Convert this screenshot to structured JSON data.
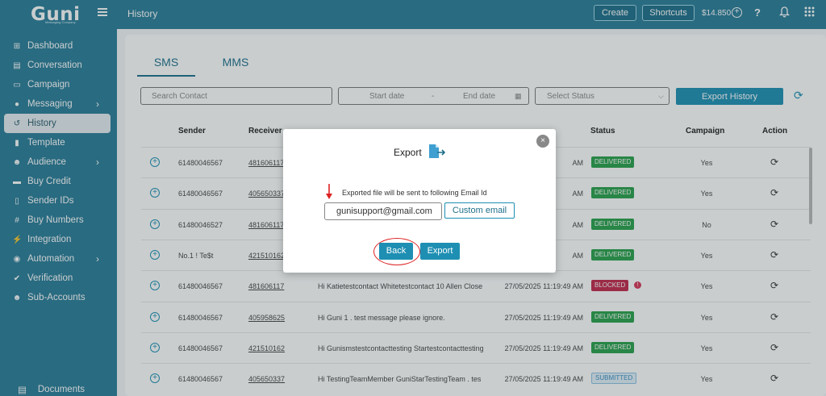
{
  "app": {
    "logo_text": "Guni",
    "logo_subtitle": "Messaging Company",
    "page_title": "History"
  },
  "topbar": {
    "create_label": "Create",
    "shortcuts_label": "Shortcuts",
    "balance": "$14.850",
    "help_label": "?"
  },
  "sidebar": {
    "items": [
      {
        "label": "Dashboard",
        "icon": "dashboard-icon",
        "glyph": "⊞"
      },
      {
        "label": "Conversation",
        "icon": "conversation-icon",
        "glyph": "▤"
      },
      {
        "label": "Campaign",
        "icon": "campaign-icon",
        "glyph": "▭"
      },
      {
        "label": "Messaging",
        "icon": "messaging-icon",
        "glyph": "●"
      },
      {
        "label": "History",
        "icon": "history-icon",
        "glyph": "↺"
      },
      {
        "label": "Template",
        "icon": "template-icon",
        "glyph": "▮"
      },
      {
        "label": "Audience",
        "icon": "audience-icon",
        "glyph": "☻"
      },
      {
        "label": "Buy Credit",
        "icon": "buy-credit-icon",
        "glyph": "▬"
      },
      {
        "label": "Sender IDs",
        "icon": "sender-ids-icon",
        "glyph": "▯"
      },
      {
        "label": "Buy Numbers",
        "icon": "buy-numbers-icon",
        "glyph": "#"
      },
      {
        "label": "Integration",
        "icon": "integration-icon",
        "glyph": "⚡"
      },
      {
        "label": "Automation",
        "icon": "automation-icon",
        "glyph": "◉"
      },
      {
        "label": "Verification",
        "icon": "verification-icon",
        "glyph": "✔"
      },
      {
        "label": "Sub-Accounts",
        "icon": "sub-accounts-icon",
        "glyph": "☻"
      }
    ],
    "bottom_item": {
      "label": "Documents",
      "icon": "documents-icon",
      "glyph": "▤"
    }
  },
  "content": {
    "tabs": [
      "SMS",
      "MMS"
    ],
    "search_placeholder": "Search Contact",
    "start_date_placeholder": "Start date",
    "date_separator": "-",
    "end_date_placeholder": "End date",
    "status_placeholder": "Select Status",
    "export_history_label": "Export History",
    "columns": [
      "Sender",
      "Receiver",
      "Status",
      "Campaign",
      "Action"
    ],
    "rows": [
      {
        "sender": "61480046567",
        "receiver": "481606117",
        "message": "",
        "time": "AM",
        "status": "DELIVERED",
        "campaign": "Yes"
      },
      {
        "sender": "61480046567",
        "receiver": "405650337",
        "message": "",
        "time": "AM",
        "status": "DELIVERED",
        "campaign": "Yes"
      },
      {
        "sender": "61480046527",
        "receiver": "481606117",
        "message": "",
        "time": "AM",
        "status": "DELIVERED",
        "campaign": "No"
      },
      {
        "sender": "No.1 ! Te$t",
        "receiver": "421510162",
        "message": "",
        "time": "AM",
        "status": "DELIVERED",
        "campaign": "Yes"
      },
      {
        "sender": "61480046567",
        "receiver": "481606117",
        "message": "Hi Katietestcontact Whitetestcontact 10 Allen Close",
        "time": "27/05/2025 11:19:49 AM",
        "status": "BLOCKED",
        "campaign": "Yes"
      },
      {
        "sender": "61480046567",
        "receiver": "405958625",
        "message": "Hi Guni 1 . test message please ignore.",
        "time": "27/05/2025 11:19:49 AM",
        "status": "DELIVERED",
        "campaign": "Yes"
      },
      {
        "sender": "61480046567",
        "receiver": "421510162",
        "message": "Hi Gunismstestcontacttesting Startestcontacttesting",
        "time": "27/05/2025 11:19:49 AM",
        "status": "DELIVERED",
        "campaign": "Yes"
      },
      {
        "sender": "61480046567",
        "receiver": "405650337",
        "message": "Hi TestingTeamMember GuniStarTestingTeam . tes",
        "time": "27/05/2025 11:19:49 AM",
        "status": "SUBMITTED",
        "campaign": "Yes"
      }
    ]
  },
  "modal": {
    "title": "Export",
    "description": "Exported file will be sent to following Email Id",
    "email_value": "gunisupport@gmail.com",
    "custom_email_label": "Custom email",
    "back_label": "Back",
    "export_label": "Export",
    "close_label": "×"
  },
  "colors": {
    "brand": "#2a7d99",
    "accent": "#1e8fb3",
    "delivered": "#29a04a",
    "blocked": "#c2274a",
    "annotation": "#dd2222"
  }
}
